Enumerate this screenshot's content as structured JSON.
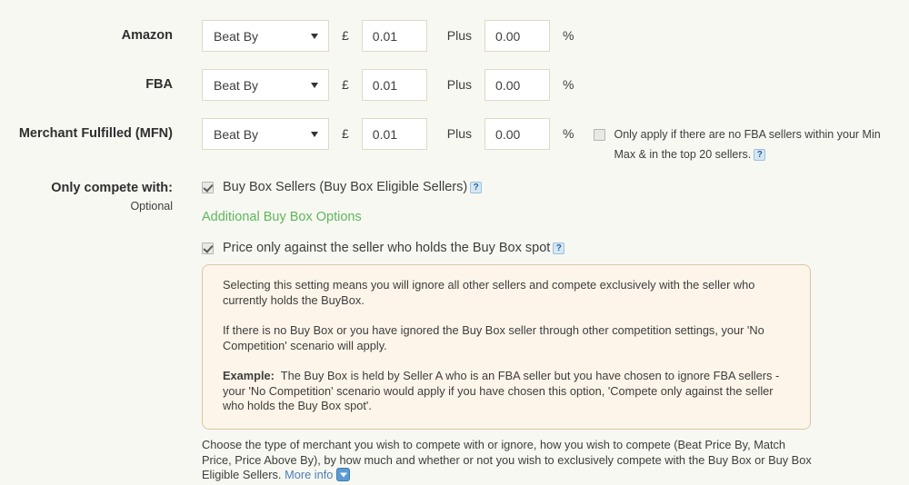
{
  "rows": [
    {
      "label": "Amazon",
      "select_value": "Beat By",
      "currency": "£",
      "amount": "0.01",
      "plus_label": "Plus",
      "percent": "0.00",
      "percent_symbol": "%"
    },
    {
      "label": "FBA",
      "select_value": "Beat By",
      "currency": "£",
      "amount": "0.01",
      "plus_label": "Plus",
      "percent": "0.00",
      "percent_symbol": "%"
    },
    {
      "label": "Merchant Fulfilled (MFN)",
      "select_value": "Beat By",
      "currency": "£",
      "amount": "0.01",
      "plus_label": "Plus",
      "percent": "0.00",
      "percent_symbol": "%",
      "note_line1": "Only apply if there are no FBA sellers within your Min",
      "note_line2": "Max & in the top 20 sellers.",
      "note_checked": false,
      "help_icon": "?"
    }
  ],
  "compete": {
    "label": "Only compete with:",
    "optional": "Optional",
    "buy_box_sellers": {
      "label": "Buy Box Sellers (Buy Box Eligible Sellers)",
      "checked": true,
      "help_icon": "?"
    },
    "additional_link": "Additional Buy Box Options",
    "price_only": {
      "label": "Price only against the seller who holds the Buy Box spot",
      "checked": true,
      "help_icon": "?"
    }
  },
  "info_panel": {
    "para1": "Selecting this setting means you will ignore all other sellers and compete exclusively with the seller who currently holds the BuyBox.",
    "para2": "If there is no Buy Box or you have ignored the Buy Box seller through other competition settings, your 'No Competition' scenario will apply.",
    "example_label": "Example:",
    "example_text": "The Buy Box is held by Seller A who is an FBA seller but you have chosen to ignore FBA sellers - your 'No Competition' scenario would apply if you have chosen this option, 'Compete only against the seller who holds the Buy Box spot'."
  },
  "footer": {
    "text": "Choose the type of merchant you wish to compete with or ignore, how you wish to compete (Beat Price By, Match Price, Price Above By), by how much and whether or not you wish to exclusively compete with the Buy Box or Buy Box Eligible Sellers.",
    "more_info": "More info"
  },
  "colors": {
    "page_bg": "#f8f8f2",
    "green_link": "#5cb75c",
    "blue_link": "#4a7fb5",
    "info_bg": "#fdf5e9",
    "info_border": "#d9c7a7",
    "field_border": "#ded9c8"
  }
}
